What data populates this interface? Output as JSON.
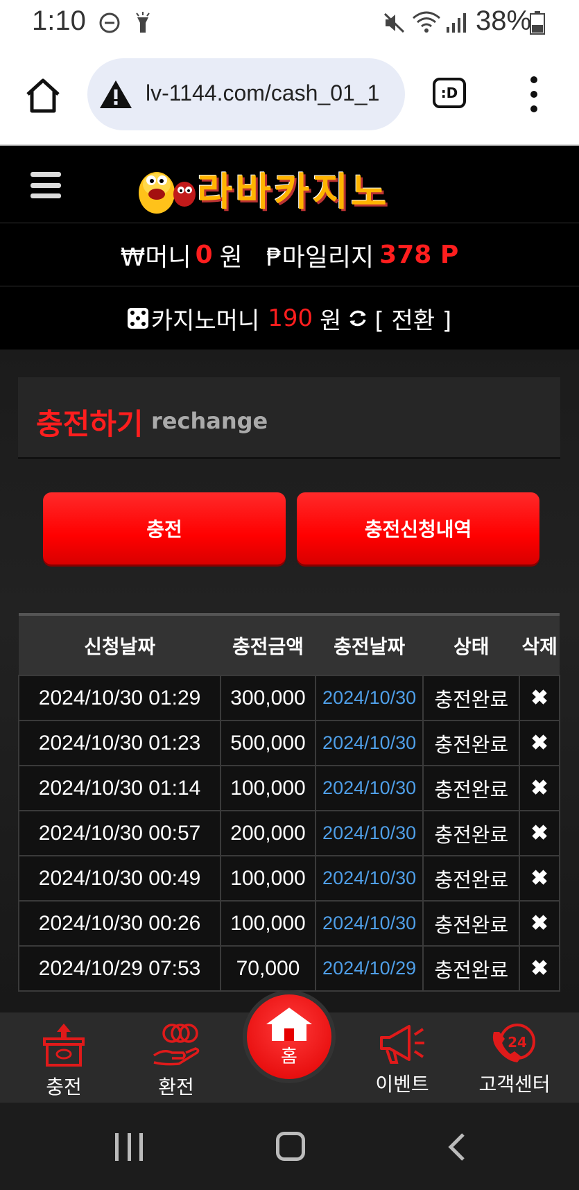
{
  "status_bar": {
    "time": "1:10",
    "battery": "38%"
  },
  "browser": {
    "url": "lv-1144.com/cash_01_1",
    "tab_label": ":D"
  },
  "site": {
    "logo_text": "라바카지노"
  },
  "balances": {
    "money_label": "₩머니",
    "money_value": "0",
    "money_unit": "원",
    "mileage_label": "₱마일리지",
    "mileage_value": "378 P",
    "casino_label": "카지노머니",
    "casino_value": "190",
    "casino_unit": "원",
    "convert_label": "[ 전환 ]"
  },
  "section": {
    "title_ko": "충전하기",
    "title_en": "rechange"
  },
  "buttons": {
    "charge": "충전",
    "history": "충전신청내역"
  },
  "table": {
    "headers": [
      "신청날짜",
      "충전금액",
      "충전날짜",
      "상태",
      "삭제"
    ],
    "rows": [
      {
        "req": "2024/10/30 01:29",
        "amount": "300,000",
        "date": "2024/10/30",
        "status": "충전완료",
        "del": "✖"
      },
      {
        "req": "2024/10/30 01:23",
        "amount": "500,000",
        "date": "2024/10/30",
        "status": "충전완료",
        "del": "✖"
      },
      {
        "req": "2024/10/30 01:14",
        "amount": "100,000",
        "date": "2024/10/30",
        "status": "충전완료",
        "del": "✖"
      },
      {
        "req": "2024/10/30 00:57",
        "amount": "200,000",
        "date": "2024/10/30",
        "status": "충전완료",
        "del": "✖"
      },
      {
        "req": "2024/10/30 00:49",
        "amount": "100,000",
        "date": "2024/10/30",
        "status": "충전완료",
        "del": "✖"
      },
      {
        "req": "2024/10/30 00:26",
        "amount": "100,000",
        "date": "2024/10/30",
        "status": "충전완료",
        "del": "✖"
      },
      {
        "req": "2024/10/29 07:53",
        "amount": "70,000",
        "date": "2024/10/29",
        "status": "충전완료",
        "del": "✖"
      }
    ]
  },
  "bottom_nav": {
    "charge": "충전",
    "exchange": "환전",
    "home": "홈",
    "event": "이벤트",
    "support": "고객센터"
  },
  "colors": {
    "accent": "#ff1e1e",
    "link_blue": "#4f9fe8",
    "logo_gold": "#ffb400"
  }
}
